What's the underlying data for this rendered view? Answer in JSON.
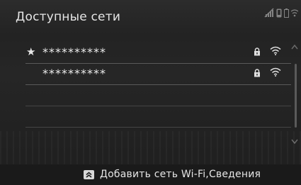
{
  "header": {
    "title": "Доступные сети"
  },
  "status_icons": [
    "signal-off-icon",
    "phone-icon",
    "battery-icon",
    "wifi-status-icon"
  ],
  "networks": [
    {
      "favorite": true,
      "favorite_glyph": "★",
      "ssid": "**********",
      "secured": true,
      "signal": "wifi-icon"
    },
    {
      "favorite": false,
      "favorite_glyph": "",
      "ssid": "**********",
      "secured": true,
      "signal": "wifi-icon"
    }
  ],
  "footer": {
    "add_label": "Добавить сеть Wi-Fi,Сведения"
  },
  "colors": {
    "background": "#222222",
    "text": "#e6e6e6",
    "divider": "#5a5a5a"
  }
}
